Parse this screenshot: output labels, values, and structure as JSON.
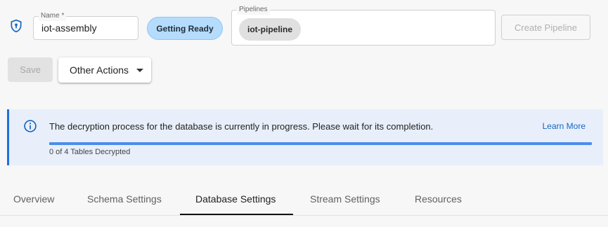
{
  "form": {
    "name_label": "Name *",
    "name_value": "iot-assembly",
    "status": "Getting Ready",
    "pipelines_label": "Pipelines",
    "pipeline_chip": "iot-pipeline",
    "create_pipeline": "Create Pipeline"
  },
  "actions": {
    "save": "Save",
    "other_actions": "Other Actions"
  },
  "alert": {
    "message": "The decryption process for the database is currently in progress. Please wait for its completion.",
    "learn_more": "Learn More",
    "progress_text": "0 of 4 Tables Decrypted",
    "progress_fraction": 1.0
  },
  "tabs": [
    {
      "label": "Overview"
    },
    {
      "label": "Schema Settings"
    },
    {
      "label": "Database Settings"
    },
    {
      "label": "Stream Settings"
    },
    {
      "label": "Resources"
    }
  ],
  "active_tab": "Database Settings",
  "colors": {
    "accent": "#1f6fe0",
    "status_pill": "#b5dcfd",
    "link": "#1565c0"
  }
}
